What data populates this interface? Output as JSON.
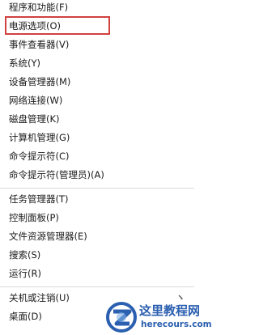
{
  "menu": {
    "items": [
      {
        "label": "程序和功能(F)"
      },
      {
        "label": "电源选项(O)"
      },
      {
        "label": "事件查看器(V)"
      },
      {
        "label": "系统(Y)"
      },
      {
        "label": "设备管理器(M)"
      },
      {
        "label": "网络连接(W)"
      },
      {
        "label": "磁盘管理(K)"
      },
      {
        "label": "计算机管理(G)"
      },
      {
        "label": "命令提示符(C)"
      },
      {
        "label": "命令提示符(管理员)(A)"
      },
      {
        "label": "任务管理器(T)"
      },
      {
        "label": "控制面板(P)"
      },
      {
        "label": "文件资源管理器(E)"
      },
      {
        "label": "搜索(S)"
      },
      {
        "label": "运行(R)"
      },
      {
        "label": "关机或注销(U)"
      },
      {
        "label": "桌面(D)"
      }
    ],
    "highlighted_item": "电源选项(O)",
    "highlight_color": "#d0413f",
    "submenu_icon": "chevron-right-icon"
  },
  "watermark": {
    "title": "这里教程网",
    "url": "herecours.com",
    "color": "#2b5fb0"
  }
}
